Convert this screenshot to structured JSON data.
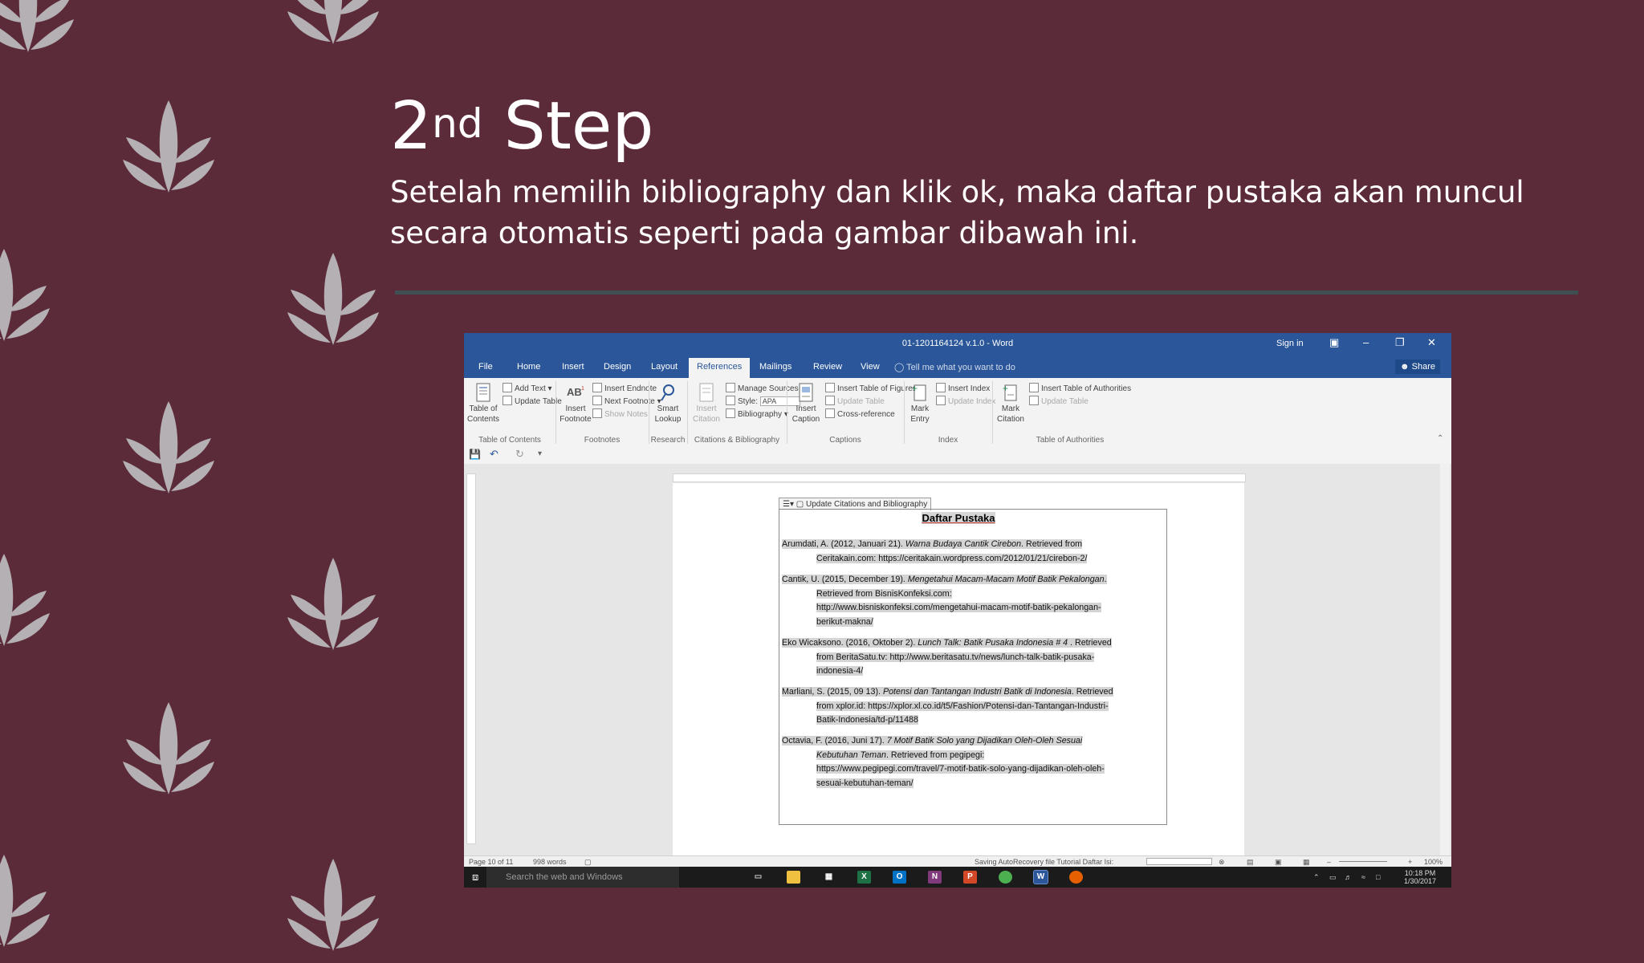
{
  "slide": {
    "title_main": "2",
    "title_sup": "nd",
    "title_rest": " Step",
    "subtitle": "Setelah memilih bibliography dan klik ok, maka daftar pustaka akan muncul secara otomatis seperti pada gambar dibawah ini."
  },
  "colors": {
    "background": "#5c2b3a",
    "leaf": "#b5b0b3",
    "divider": "#3f5052",
    "word_blue": "#2b579a"
  },
  "word": {
    "doc_title": "01-1201164124 v.1.0  -  Word",
    "sign_in": "Sign in",
    "window_icons": [
      "ribbon-display-icon",
      "minimize-icon",
      "restore-icon",
      "close-icon"
    ],
    "tabs": [
      "File",
      "Home",
      "Insert",
      "Design",
      "Layout",
      "References",
      "Mailings",
      "Review",
      "View"
    ],
    "active_tab": "References",
    "tell_me": "Tell me what you want to do",
    "share": "Share",
    "ribbon": {
      "toc_label": "Table of Contents",
      "add_text": "Add Text",
      "update_table": "Update Table",
      "group_toc": "Table of Contents",
      "insert_footnote": "Insert Footnote",
      "insert_endnote": "Insert Endnote",
      "next_footnote": "Next Footnote",
      "show_notes": "Show Notes",
      "group_footnotes": "Footnotes",
      "smart_lookup": "Smart Lookup",
      "group_research": "Research",
      "insert_citation": "Insert Citation",
      "manage_sources": "Manage Sources",
      "style_label": "Style:",
      "style_value": "APA",
      "bibliography": "Bibliography",
      "group_citations": "Citations & Bibliography",
      "insert_caption": "Insert Caption",
      "insert_tof": "Insert Table of Figures",
      "update_table2": "Update Table",
      "cross_reference": "Cross-reference",
      "group_captions": "Captions",
      "mark_entry": "Mark Entry",
      "insert_index": "Insert Index",
      "update_index": "Update Index",
      "group_index": "Index",
      "mark_citation": "Mark Citation",
      "insert_toa": "Insert Table of Authorities",
      "update_table3": "Update Table",
      "group_toa": "Table of Authorities"
    },
    "cc_tab_label": "Update Citations and Bibliography",
    "biblio_title": "Daftar Pustaka",
    "entries": [
      {
        "l1a": "Arumdati, A. (2012, Januari 21). ",
        "l1i": "Warna Budaya Cantik Cirebon",
        "l1b": ". Retrieved from",
        "rest": [
          "Ceritakain.com: https://ceritakain.wordpress.com/2012/01/21/cirebon-2/"
        ]
      },
      {
        "l1a": "Cantik, U. (2015, December 19). ",
        "l1i": "Mengetahui Macam-Macam Motif Batik Pekalongan",
        "l1b": ".",
        "rest": [
          "Retrieved from BisnisKonfeksi.com:",
          "http://www.bisniskonfeksi.com/mengetahui-macam-motif-batik-pekalongan-",
          "berikut-makna/"
        ]
      },
      {
        "l1a": "Eko Wicaksono. (2016, Oktober 2). ",
        "l1i": "Lunch Talk: Batik Pusaka Indonesia # 4",
        "l1b": " . Retrieved",
        "rest": [
          "from BeritaSatu.tv: http://www.beritasatu.tv/news/lunch-talk-batik-pusaka-",
          "indonesia-4/"
        ]
      },
      {
        "l1a": "Marliani, S. (2015, 09 13). ",
        "l1i": "Potensi dan Tantangan Industri Batik di Indonesia",
        "l1b": ". Retrieved",
        "rest": [
          "from xplor.id: https://xplor.xl.co.id/t5/Fashion/Potensi-dan-Tantangan-Industri-",
          "Batik-Indonesia/td-p/11488"
        ]
      },
      {
        "l1a": "Octavia, F. (2016, Juni 17). ",
        "l1i": "7 Motif Batik Solo yang Dijadikan Oleh-Oleh Sesuai",
        "l1b": "",
        "l2i": "Kebutuhan Teman",
        "l2b": ". Retrieved from pegipegi:",
        "rest": [
          "https://www.pegipegi.com/travel/7-motif-batik-solo-yang-dijadikan-oleh-oleh-",
          "sesuai-kebutuhan-teman/"
        ]
      }
    ],
    "status": {
      "page": "Page 10 of 11",
      "words": "998 words",
      "autorecovery": "Saving AutoRecovery file Tutorial Daftar Isi:",
      "zoom": "100%"
    },
    "taskbar": {
      "search": "Search the web and Windows",
      "time": "10:18 PM",
      "date": "1/30/2017"
    }
  }
}
